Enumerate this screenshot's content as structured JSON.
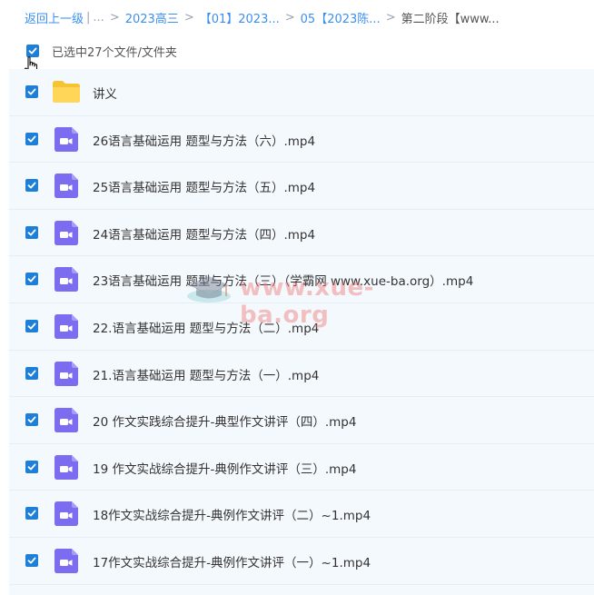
{
  "breadcrumb": {
    "back": "返回上一级",
    "sep1": "|",
    "ellipsis": "...",
    "arrow": ">",
    "crumb1": "2023高三",
    "crumb2": "【01】2023...",
    "crumb3": "05【2023陈...",
    "current": "第二阶段【www..."
  },
  "selection": {
    "text": "已选中27个文件/文件夹"
  },
  "watermark": {
    "text": "www.xue-ba.org"
  },
  "files": [
    {
      "type": "folder",
      "name": "讲义"
    },
    {
      "type": "video",
      "name": "26语言基础运用 题型与方法（六）.mp4"
    },
    {
      "type": "video",
      "name": "25语言基础运用 题型与方法（五）.mp4"
    },
    {
      "type": "video",
      "name": "24语言基础运用 题型与方法（四）.mp4"
    },
    {
      "type": "video",
      "name": "23语言基础运用 题型与方法（三）（学霸网 www.xue-ba.org）.mp4"
    },
    {
      "type": "video",
      "name": "22.语言基础运用 题型与方法（二）.mp4"
    },
    {
      "type": "video",
      "name": "21.语言基础运用 题型与方法（一）.mp4"
    },
    {
      "type": "video",
      "name": "20 作文实践综合提升-典型作文讲评（四）.mp4"
    },
    {
      "type": "video",
      "name": "19 作文实战综合提升-典例作文讲评（三）.mp4"
    },
    {
      "type": "video",
      "name": "18作文实战综合提升-典例作文讲评（二）~1.mp4"
    },
    {
      "type": "video",
      "name": "17作文实战综合提升-典例作文讲评（一）~1.mp4"
    }
  ],
  "colors": {
    "accent": "#1e7fd9",
    "video_icon": "#7b6cf0",
    "folder": "#ffd04a"
  }
}
